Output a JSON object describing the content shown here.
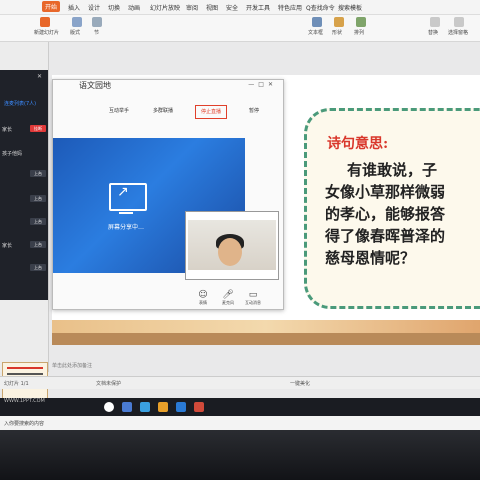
{
  "menu": {
    "items": [
      "开始",
      "插入",
      "设计",
      "切换",
      "动画",
      "幻灯片放映",
      "审阅",
      "视图",
      "安全",
      "开发工具",
      "特色应用",
      "Q查找命令",
      "搜索模板"
    ]
  },
  "toolbar": {
    "items": [
      "新建幻灯片",
      "版式",
      "节",
      "文本框",
      "形状",
      "排列",
      "替换",
      "选择窗格"
    ]
  },
  "member_panel": {
    "header": "连麦列表(7人)",
    "rows": [
      {
        "label": "家长",
        "btn": "挂断"
      },
      {
        "label": "孩子他妈",
        "btn": "上台"
      },
      {
        "label": "",
        "btn": "上台"
      },
      {
        "label": "",
        "btn": "上台"
      },
      {
        "label": "家长",
        "btn": "上台"
      },
      {
        "label": "",
        "btn": "上台"
      }
    ]
  },
  "live_window": {
    "title": "语文园地",
    "tabs": [
      "互动举手",
      "多群联播",
      "停止直播",
      "暂停"
    ],
    "share_text": "屏幕分享中…",
    "bottom_icons": [
      {
        "icon": "emoji-icon",
        "label": "表情"
      },
      {
        "icon": "mic-icon",
        "label": "麦克风"
      },
      {
        "icon": "comment-icon",
        "label": "互动消息"
      }
    ]
  },
  "poem": {
    "title": "诗句意思:",
    "lines": [
      "有谁敢说，子",
      "女像小草那样微弱",
      "的孝心，能够报答",
      "得了像春晖普泽的",
      "慈母恩情呢？"
    ]
  },
  "notes_hint": "单击此处添加备注",
  "status": {
    "left": "幻灯片 1/1",
    "center": "文档未保护",
    "zoom": "一键美化"
  },
  "taskbar": {
    "text": "WWW.1PPT.COM"
  },
  "tip": "入你要搜索的内容",
  "colors": {
    "accent": "#e8672a",
    "poem_title": "#d9372b",
    "card_border": "#4a9a7a",
    "share_bg": "#2b7de0"
  }
}
